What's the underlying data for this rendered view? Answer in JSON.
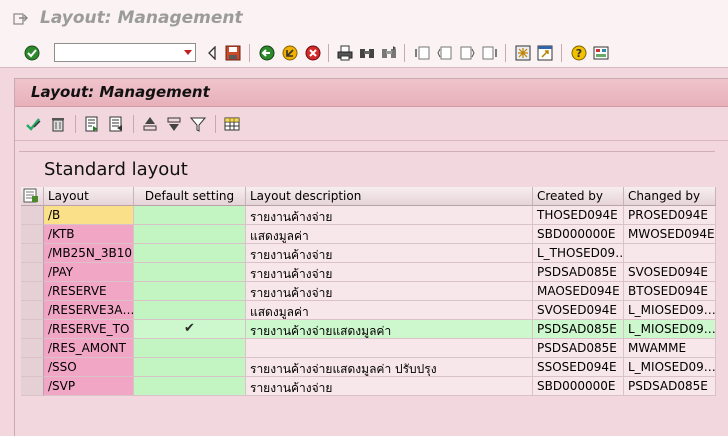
{
  "window": {
    "title": "Layout: Management"
  },
  "toolbar": {
    "command_field_value": "",
    "icons": [
      "enter-icon",
      "back-arrow-icon",
      "save-icon",
      "back-icon",
      "exit-icon",
      "cancel-icon",
      "print-icon",
      "find-icon",
      "find-next-icon",
      "first-page-icon",
      "prev-page-icon",
      "next-page-icon",
      "last-page-icon",
      "new-session-icon",
      "shortcut-icon",
      "help-icon",
      "customize-layout-icon"
    ]
  },
  "dialog": {
    "title": "Layout: Management",
    "app_toolbar_icons": [
      "check-icon",
      "delete-icon",
      "transport-icon",
      "import-icon",
      "sort-ascending-icon",
      "sort-descending-icon",
      "filter-icon",
      "details-icon"
    ],
    "section_label": "Standard layout",
    "table": {
      "columns": [
        "Layout",
        "Default setting",
        "Layout description",
        "Created by",
        "Changed by"
      ],
      "rows": [
        {
          "layout": "/B",
          "default": "",
          "description": "รายงานค้างจ่าย",
          "created_by": "THOSED094E",
          "changed_by": "PROSED094E"
        },
        {
          "layout": "/KTB",
          "default": "",
          "description": "แสดงมูลค่า",
          "created_by": "SBD000000E",
          "changed_by": "MWOSED094E"
        },
        {
          "layout": "/MB25N_3B10",
          "default": "",
          "description": "รายงานค้างจ่าย",
          "created_by": "L_THOSED09…",
          "changed_by": ""
        },
        {
          "layout": "/PAY",
          "default": "",
          "description": "รายงานค้างจ่าย",
          "created_by": "PSDSAD085E",
          "changed_by": "SVOSED094E"
        },
        {
          "layout": "/RESERVE",
          "default": "",
          "description": "รายงานค้างจ่าย",
          "created_by": "MAOSED094E",
          "changed_by": "BTOSED094E"
        },
        {
          "layout": "/RESERVE3A…",
          "default": "",
          "description": "แสดงมูลค่า",
          "created_by": "SVOSED094E",
          "changed_by": "L_MIOSED09…"
        },
        {
          "layout": "/RESERVE_TO",
          "default": "✔",
          "description": "รายงานค้างจ่ายแสดงมูลค่า",
          "created_by": "PSDSAD085E",
          "changed_by": "L_MIOSED09…"
        },
        {
          "layout": "/RES_AMONT",
          "default": "",
          "description": "",
          "created_by": "PSDSAD085E",
          "changed_by": "MWAMME"
        },
        {
          "layout": "/SSO",
          "default": "",
          "description": "รายงานค้างจ่ายแสดงมูลค่า ปรับปรุง",
          "created_by": "SSOSED094E",
          "changed_by": "L_MIOSED09…"
        },
        {
          "layout": "/SVP",
          "default": "",
          "description": "รายงานค้างจ่าย",
          "created_by": "SBD000000E",
          "changed_by": "PSDSAD085E"
        }
      ]
    }
  }
}
